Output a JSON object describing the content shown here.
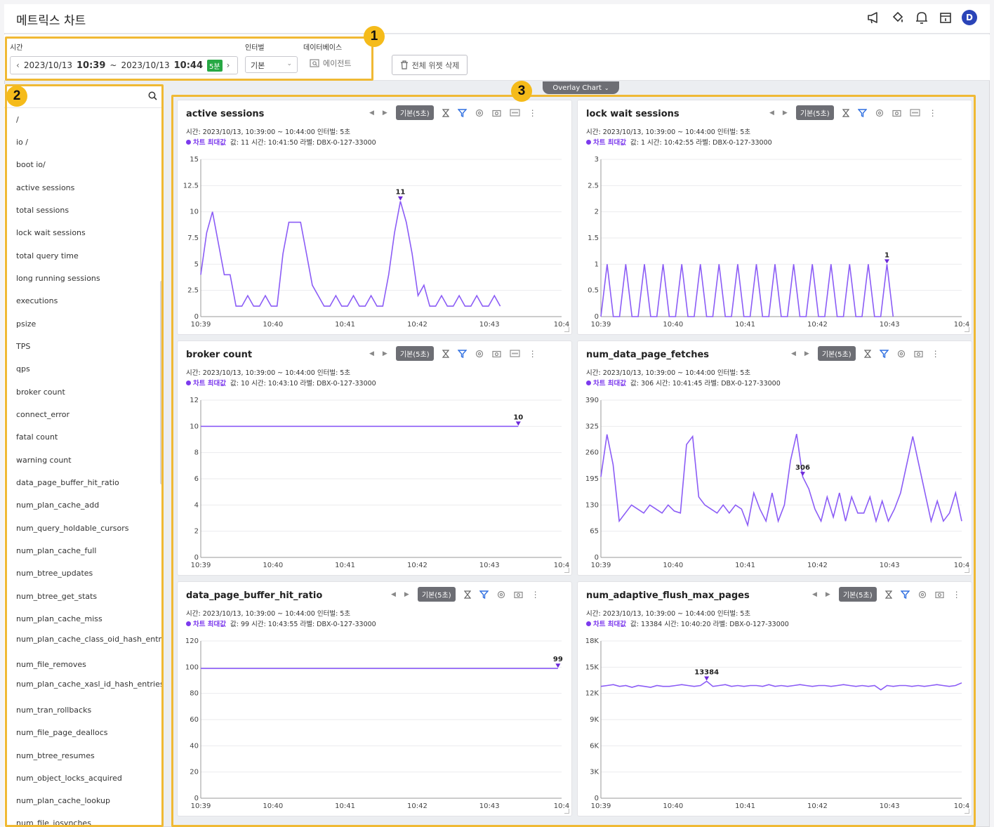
{
  "app": {
    "title": "메트릭스 차트",
    "avatar": "D"
  },
  "header_icons": [
    "megaphone-icon",
    "paint-bucket-icon",
    "bell-icon",
    "calendar-icon",
    "avatar"
  ],
  "filters": {
    "time_label": "시간",
    "time_start_date": "2023/10/13",
    "time_start_clock": "10:39",
    "time_sep": "~",
    "time_end_date": "2023/10/13",
    "time_end_clock": "10:44",
    "time_badge": "5분",
    "interval_label": "인터벌",
    "interval_value": "기본",
    "database_label": "데이터베이스",
    "agent_button": "에이전트",
    "delete_all_button": "전체 위젯 삭제"
  },
  "callouts": [
    "1",
    "2",
    "3"
  ],
  "overlay_tab": "Overlay Chart",
  "sidebar": {
    "search_value": "",
    "items": [
      "/",
      "io /",
      "boot io/",
      "active sessions",
      "total sessions",
      "lock wait sessions",
      "total query time",
      "long running sessions",
      "executions",
      "psize",
      "TPS",
      "qps",
      "broker count",
      "connect_error",
      "fatal count",
      "warning count",
      "data_page_buffer_hit_ratio",
      "num_plan_cache_add",
      "num_query_holdable_cursors",
      "num_plan_cache_full",
      "num_btree_updates",
      "num_btree_get_stats",
      "num_plan_cache_miss",
      "num_plan_cache_class_oid_hash_entries",
      "num_file_removes",
      "num_plan_cache_xasl_id_hash_entries",
      "num_tran_rollbacks",
      "num_file_page_deallocs",
      "num_btree_resumes",
      "num_object_locks_acquired",
      "num_plan_cache_lookup",
      "num_file_iosynches"
    ]
  },
  "common": {
    "pill": "기본(5초)",
    "meta": "시간: 2023/10/13, 10:39:00 ~ 10:44:00  인터벌: 5초",
    "max_label": "차트 최대값",
    "x_ticks": [
      "10:39",
      "10:40",
      "10:41",
      "10:42",
      "10:43",
      "10:4"
    ]
  },
  "charts": [
    {
      "title": "active sessions",
      "max_text": "값: 11   시간: 10:41:50   라벨: DBX-0-127-33000",
      "color": "#8b5cf6",
      "y_ticks": [
        "15",
        "12.5",
        "10",
        "7.5",
        "5",
        "2.5",
        "0"
      ],
      "annotation": "11",
      "chart_data": {
        "type": "line",
        "ylim": [
          0,
          15
        ],
        "peak_index": 34,
        "values": [
          4,
          8,
          10,
          7,
          4,
          4,
          1,
          1,
          2,
          1,
          1,
          2,
          1,
          1,
          6,
          9,
          9,
          9,
          6,
          3,
          2,
          1,
          1,
          2,
          1,
          1,
          2,
          1,
          1,
          2,
          1,
          1,
          4,
          8,
          11,
          9,
          6,
          2,
          3,
          1,
          1,
          2,
          1,
          1,
          2,
          1,
          1,
          2,
          1,
          1,
          2,
          1
        ]
      }
    },
    {
      "title": "lock wait sessions",
      "max_text": "값: 1   시간: 10:42:55   라벨: DBX-0-127-33000",
      "color": "#8b5cf6",
      "y_ticks": [
        "3",
        "2.5",
        "2",
        "1.5",
        "1",
        "0.5",
        "0"
      ],
      "annotation": "1",
      "chart_data": {
        "type": "line",
        "ylim": [
          0,
          3
        ],
        "peak_index": 46,
        "values": [
          0,
          1,
          0,
          0,
          1,
          0,
          0,
          1,
          0,
          0,
          1,
          0,
          0,
          1,
          0,
          0,
          1,
          0,
          0,
          1,
          0,
          0,
          1,
          0,
          0,
          1,
          0,
          0,
          1,
          0,
          0,
          1,
          0,
          0,
          1,
          0,
          0,
          1,
          0,
          0,
          1,
          0,
          0,
          1,
          0,
          0,
          1,
          0
        ]
      }
    },
    {
      "title": "broker count",
      "max_text": "값: 10   시간: 10:43:10   라벨: DBX-0-127-33000",
      "color": "#8b5cf6",
      "y_ticks": [
        "12",
        "10",
        "8",
        "6",
        "4",
        "2",
        "0"
      ],
      "annotation": "10",
      "chart_data": {
        "type": "line",
        "ylim": [
          0,
          12
        ],
        "constant": 10,
        "end_fraction": 0.88
      }
    },
    {
      "title": "num_data_page_fetches",
      "max_text": "값: 306   시간: 10:41:45   라벨: DBX-0-127-33000",
      "color": "#8b5cf6",
      "y_ticks": [
        "390",
        "325",
        "260",
        "195",
        "130",
        "65",
        "0"
      ],
      "annotation": "306",
      "chart_data": {
        "type": "line",
        "ylim": [
          0,
          390
        ],
        "peak_index": 33,
        "values": [
          200,
          305,
          230,
          90,
          110,
          130,
          120,
          110,
          130,
          120,
          110,
          130,
          115,
          110,
          280,
          300,
          150,
          130,
          120,
          110,
          130,
          110,
          130,
          120,
          80,
          160,
          120,
          90,
          160,
          90,
          130,
          240,
          306,
          200,
          170,
          120,
          90,
          150,
          100,
          160,
          90,
          150,
          110,
          110,
          150,
          90,
          140,
          90,
          120,
          160,
          230,
          300,
          230,
          160,
          90,
          140,
          90,
          110,
          160,
          90
        ]
      }
    },
    {
      "title": "data_page_buffer_hit_ratio",
      "max_text": "값: 99   시간: 10:43:55   라벨: DBX-0-127-33000",
      "color": "#8b5cf6",
      "y_ticks": [
        "120",
        "100",
        "80",
        "60",
        "40",
        "20",
        "0"
      ],
      "annotation": "99",
      "chart_data": {
        "type": "line",
        "ylim": [
          0,
          120
        ],
        "constant": 99,
        "end_fraction": 0.99
      }
    },
    {
      "title": "num_adaptive_flush_max_pages",
      "max_text": "값: 13384   시간: 10:40:20   라벨: DBX-0-127-33000",
      "color": "#8b5cf6",
      "y_ticks": [
        "18K",
        "15K",
        "12K",
        "9K",
        "6K",
        "3K",
        "0"
      ],
      "annotation": "13384",
      "chart_data": {
        "type": "line",
        "ylim": [
          0,
          18000
        ],
        "peak_index": 17,
        "values": [
          12800,
          12900,
          13000,
          12800,
          12900,
          12700,
          12900,
          12800,
          12700,
          12900,
          12800,
          12800,
          12900,
          13000,
          12900,
          12800,
          12900,
          13384,
          12800,
          12900,
          13000,
          12800,
          12900,
          12800,
          12900,
          12900,
          12800,
          13000,
          12800,
          12900,
          12800,
          12900,
          13000,
          12900,
          12800,
          12900,
          12900,
          12800,
          12900,
          13000,
          12900,
          12800,
          12900,
          12800,
          12900,
          12400,
          12900,
          12800,
          12900,
          12900,
          12800,
          12900,
          12800,
          12900,
          13000,
          12900,
          12800,
          12900,
          13200
        ]
      }
    }
  ]
}
